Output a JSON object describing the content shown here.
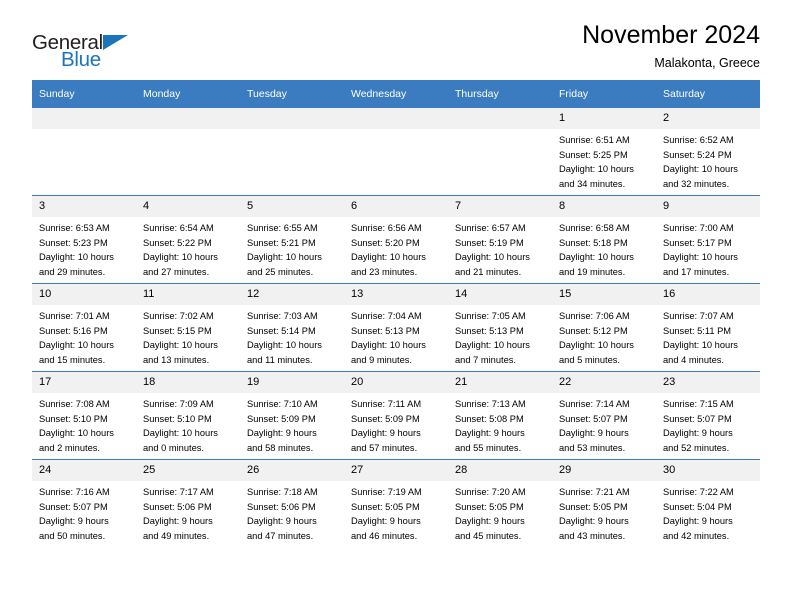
{
  "brand": {
    "name_part1": "General",
    "name_part2": "Blue",
    "logo_icon": "triangle-flag-icon",
    "accent_color": "#1b75bb"
  },
  "header": {
    "month_title": "November 2024",
    "location": "Malakonta, Greece"
  },
  "theme": {
    "header_blue": "#3a7cbf",
    "daynum_band": "#f1f1f1",
    "text": "#000000"
  },
  "calendar": {
    "weekday_headers": [
      "Sunday",
      "Monday",
      "Tuesday",
      "Wednesday",
      "Thursday",
      "Friday",
      "Saturday"
    ],
    "weeks": [
      [
        {
          "day": "",
          "lines": []
        },
        {
          "day": "",
          "lines": []
        },
        {
          "day": "",
          "lines": []
        },
        {
          "day": "",
          "lines": []
        },
        {
          "day": "",
          "lines": []
        },
        {
          "day": "1",
          "lines": [
            "Sunrise: 6:51 AM",
            "Sunset: 5:25 PM",
            "Daylight: 10 hours",
            "and 34 minutes."
          ]
        },
        {
          "day": "2",
          "lines": [
            "Sunrise: 6:52 AM",
            "Sunset: 5:24 PM",
            "Daylight: 10 hours",
            "and 32 minutes."
          ]
        }
      ],
      [
        {
          "day": "3",
          "lines": [
            "Sunrise: 6:53 AM",
            "Sunset: 5:23 PM",
            "Daylight: 10 hours",
            "and 29 minutes."
          ]
        },
        {
          "day": "4",
          "lines": [
            "Sunrise: 6:54 AM",
            "Sunset: 5:22 PM",
            "Daylight: 10 hours",
            "and 27 minutes."
          ]
        },
        {
          "day": "5",
          "lines": [
            "Sunrise: 6:55 AM",
            "Sunset: 5:21 PM",
            "Daylight: 10 hours",
            "and 25 minutes."
          ]
        },
        {
          "day": "6",
          "lines": [
            "Sunrise: 6:56 AM",
            "Sunset: 5:20 PM",
            "Daylight: 10 hours",
            "and 23 minutes."
          ]
        },
        {
          "day": "7",
          "lines": [
            "Sunrise: 6:57 AM",
            "Sunset: 5:19 PM",
            "Daylight: 10 hours",
            "and 21 minutes."
          ]
        },
        {
          "day": "8",
          "lines": [
            "Sunrise: 6:58 AM",
            "Sunset: 5:18 PM",
            "Daylight: 10 hours",
            "and 19 minutes."
          ]
        },
        {
          "day": "9",
          "lines": [
            "Sunrise: 7:00 AM",
            "Sunset: 5:17 PM",
            "Daylight: 10 hours",
            "and 17 minutes."
          ]
        }
      ],
      [
        {
          "day": "10",
          "lines": [
            "Sunrise: 7:01 AM",
            "Sunset: 5:16 PM",
            "Daylight: 10 hours",
            "and 15 minutes."
          ]
        },
        {
          "day": "11",
          "lines": [
            "Sunrise: 7:02 AM",
            "Sunset: 5:15 PM",
            "Daylight: 10 hours",
            "and 13 minutes."
          ]
        },
        {
          "day": "12",
          "lines": [
            "Sunrise: 7:03 AM",
            "Sunset: 5:14 PM",
            "Daylight: 10 hours",
            "and 11 minutes."
          ]
        },
        {
          "day": "13",
          "lines": [
            "Sunrise: 7:04 AM",
            "Sunset: 5:13 PM",
            "Daylight: 10 hours",
            "and 9 minutes."
          ]
        },
        {
          "day": "14",
          "lines": [
            "Sunrise: 7:05 AM",
            "Sunset: 5:13 PM",
            "Daylight: 10 hours",
            "and 7 minutes."
          ]
        },
        {
          "day": "15",
          "lines": [
            "Sunrise: 7:06 AM",
            "Sunset: 5:12 PM",
            "Daylight: 10 hours",
            "and 5 minutes."
          ]
        },
        {
          "day": "16",
          "lines": [
            "Sunrise: 7:07 AM",
            "Sunset: 5:11 PM",
            "Daylight: 10 hours",
            "and 4 minutes."
          ]
        }
      ],
      [
        {
          "day": "17",
          "lines": [
            "Sunrise: 7:08 AM",
            "Sunset: 5:10 PM",
            "Daylight: 10 hours",
            "and 2 minutes."
          ]
        },
        {
          "day": "18",
          "lines": [
            "Sunrise: 7:09 AM",
            "Sunset: 5:10 PM",
            "Daylight: 10 hours",
            "and 0 minutes."
          ]
        },
        {
          "day": "19",
          "lines": [
            "Sunrise: 7:10 AM",
            "Sunset: 5:09 PM",
            "Daylight: 9 hours",
            "and 58 minutes."
          ]
        },
        {
          "day": "20",
          "lines": [
            "Sunrise: 7:11 AM",
            "Sunset: 5:09 PM",
            "Daylight: 9 hours",
            "and 57 minutes."
          ]
        },
        {
          "day": "21",
          "lines": [
            "Sunrise: 7:13 AM",
            "Sunset: 5:08 PM",
            "Daylight: 9 hours",
            "and 55 minutes."
          ]
        },
        {
          "day": "22",
          "lines": [
            "Sunrise: 7:14 AM",
            "Sunset: 5:07 PM",
            "Daylight: 9 hours",
            "and 53 minutes."
          ]
        },
        {
          "day": "23",
          "lines": [
            "Sunrise: 7:15 AM",
            "Sunset: 5:07 PM",
            "Daylight: 9 hours",
            "and 52 minutes."
          ]
        }
      ],
      [
        {
          "day": "24",
          "lines": [
            "Sunrise: 7:16 AM",
            "Sunset: 5:07 PM",
            "Daylight: 9 hours",
            "and 50 minutes."
          ]
        },
        {
          "day": "25",
          "lines": [
            "Sunrise: 7:17 AM",
            "Sunset: 5:06 PM",
            "Daylight: 9 hours",
            "and 49 minutes."
          ]
        },
        {
          "day": "26",
          "lines": [
            "Sunrise: 7:18 AM",
            "Sunset: 5:06 PM",
            "Daylight: 9 hours",
            "and 47 minutes."
          ]
        },
        {
          "day": "27",
          "lines": [
            "Sunrise: 7:19 AM",
            "Sunset: 5:05 PM",
            "Daylight: 9 hours",
            "and 46 minutes."
          ]
        },
        {
          "day": "28",
          "lines": [
            "Sunrise: 7:20 AM",
            "Sunset: 5:05 PM",
            "Daylight: 9 hours",
            "and 45 minutes."
          ]
        },
        {
          "day": "29",
          "lines": [
            "Sunrise: 7:21 AM",
            "Sunset: 5:05 PM",
            "Daylight: 9 hours",
            "and 43 minutes."
          ]
        },
        {
          "day": "30",
          "lines": [
            "Sunrise: 7:22 AM",
            "Sunset: 5:04 PM",
            "Daylight: 9 hours",
            "and 42 minutes."
          ]
        }
      ]
    ]
  }
}
